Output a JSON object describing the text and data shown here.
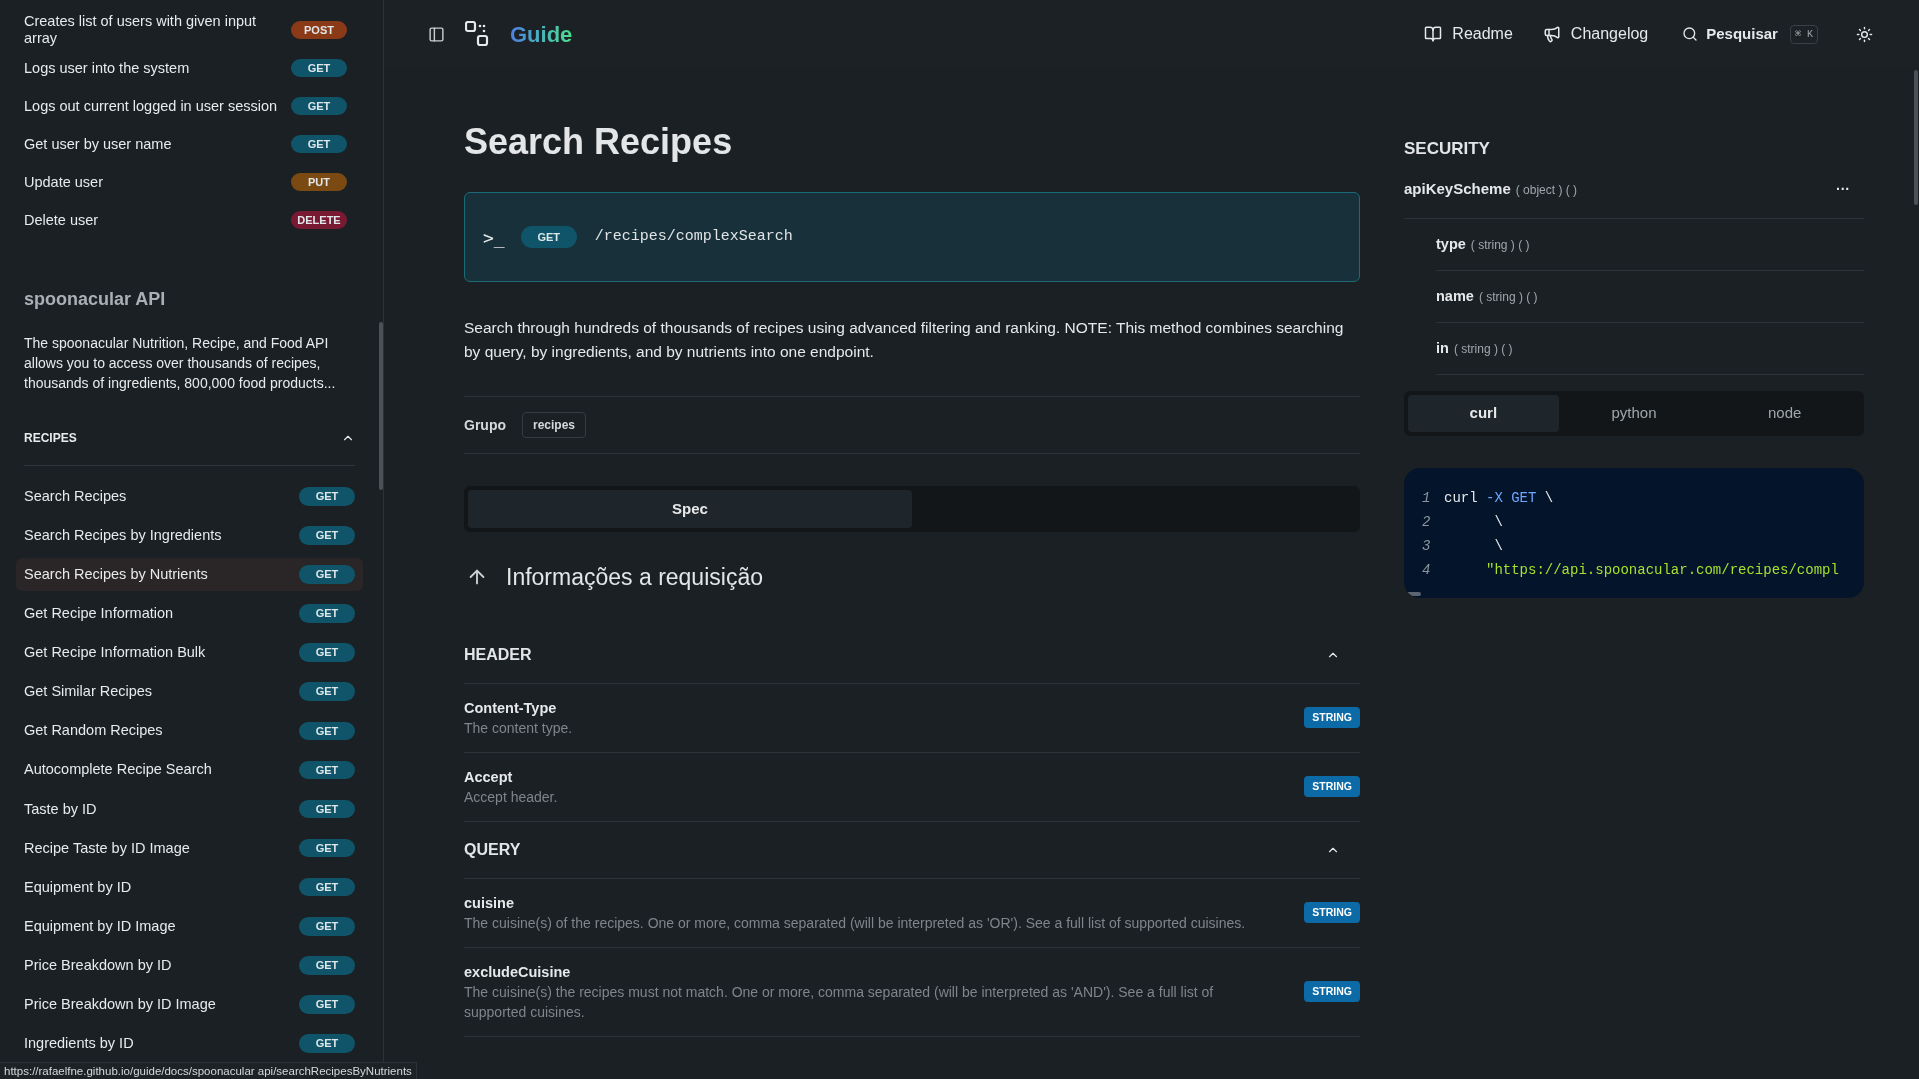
{
  "sidebar": {
    "top_items": [
      {
        "label": "Creates list of users with given input array",
        "method": "POST",
        "color": "#8a3a16"
      },
      {
        "label": "Logs user into the system",
        "method": "GET",
        "color": "#0f5468"
      },
      {
        "label": "Logs out current logged in user session",
        "method": "GET",
        "color": "#0f5468"
      },
      {
        "label": "Get user by user name",
        "method": "GET",
        "color": "#0f5468"
      },
      {
        "label": "Update user",
        "method": "PUT",
        "color": "#7a4a12"
      },
      {
        "label": "Delete user",
        "method": "DELETE",
        "color": "#7a1a32"
      }
    ],
    "api": {
      "title": "spoonacular API",
      "description": "The spoonacular Nutrition, Recipe, and Food API allows you to access over thousands of recipes, thousands of ingredients, 800,000 food products..."
    },
    "section": {
      "title": "RECIPES",
      "expanded": true
    },
    "items": [
      {
        "label": "Search Recipes",
        "method": "GET",
        "color": "#0f5468",
        "selected": false
      },
      {
        "label": "Search Recipes by Ingredients",
        "method": "GET",
        "color": "#0f5468",
        "selected": false
      },
      {
        "label": "Search Recipes by Nutrients",
        "method": "GET",
        "color": "#0f5468",
        "selected": true
      },
      {
        "label": "Get Recipe Information",
        "method": "GET",
        "color": "#0f5468",
        "selected": false
      },
      {
        "label": "Get Recipe Information Bulk",
        "method": "GET",
        "color": "#0f5468",
        "selected": false
      },
      {
        "label": "Get Similar Recipes",
        "method": "GET",
        "color": "#0f5468",
        "selected": false
      },
      {
        "label": "Get Random Recipes",
        "method": "GET",
        "color": "#0f5468",
        "selected": false
      },
      {
        "label": "Autocomplete Recipe Search",
        "method": "GET",
        "color": "#0f5468",
        "selected": false
      },
      {
        "label": "Taste by ID",
        "method": "GET",
        "color": "#0f5468",
        "selected": false
      },
      {
        "label": "Recipe Taste by ID Image",
        "method": "GET",
        "color": "#0f5468",
        "selected": false
      },
      {
        "label": "Equipment by ID",
        "method": "GET",
        "color": "#0f5468",
        "selected": false
      },
      {
        "label": "Equipment by ID Image",
        "method": "GET",
        "color": "#0f5468",
        "selected": false
      },
      {
        "label": "Price Breakdown by ID",
        "method": "GET",
        "color": "#0f5468",
        "selected": false
      },
      {
        "label": "Price Breakdown by ID Image",
        "method": "GET",
        "color": "#0f5468",
        "selected": false
      },
      {
        "label": "Ingredients by ID",
        "method": "GET",
        "color": "#0f5468",
        "selected": false
      }
    ]
  },
  "header": {
    "brand": "Guide",
    "links": [
      "Readme",
      "Changelog"
    ],
    "search": {
      "label": "Pesquisar",
      "shortcut": "⌘ K"
    }
  },
  "main": {
    "title": "Search Recipes",
    "endpoint": {
      "prompt": ">_",
      "method": "GET",
      "color": "#0f5468",
      "path": "/recipes/complexSearch"
    },
    "description": "Search through hundreds of thousands of recipes using advanced filtering and ranking. NOTE: This method combines searching by query, by ingredients, and by nutrients into one endpoint.",
    "group": {
      "label": "Grupo",
      "tag": "recipes"
    },
    "spec_tabs": [
      {
        "label": "Spec",
        "selected": true
      }
    ],
    "request_title": "Informações a requisição",
    "sections": [
      {
        "title": "HEADER",
        "expanded": true,
        "params": [
          {
            "name": "Content-Type",
            "description": "The content type.",
            "type": "STRING"
          },
          {
            "name": "Accept",
            "description": "Accept header.",
            "type": "STRING"
          }
        ]
      },
      {
        "title": "QUERY",
        "expanded": true,
        "params": [
          {
            "name": "cuisine",
            "description": "The cuisine(s) of the recipes. One or more, comma separated (will be interpreted as 'OR'). See a full list of supported cuisines.",
            "type": "STRING"
          },
          {
            "name": "excludeCuisine",
            "description": "The cuisine(s) the recipes must not match. One or more, comma separated (will be interpreted as 'AND'). See a full list of supported cuisines.",
            "type": "STRING"
          }
        ]
      }
    ]
  },
  "security": {
    "title": "SECURITY",
    "scheme": {
      "name": "apiKeyScheme",
      "meta": "( object ) ( )",
      "more": "···"
    },
    "fields": [
      {
        "name": "type",
        "meta": "( string ) ( )"
      },
      {
        "name": "name",
        "meta": "( string ) ( )"
      },
      {
        "name": "in",
        "meta": "( string ) ( )"
      }
    ]
  },
  "code_tabs": [
    {
      "label": "curl",
      "selected": true
    },
    {
      "label": "python",
      "selected": false
    },
    {
      "label": "node",
      "selected": false
    }
  ],
  "code": [
    {
      "number": "1",
      "tokens": [
        {
          "kind": "plain",
          "text": "curl "
        },
        {
          "kind": "keyword",
          "text": "-X GET "
        },
        {
          "kind": "plain",
          "text": "\\"
        }
      ]
    },
    {
      "number": "2",
      "tokens": [
        {
          "kind": "plain",
          "text": "      \\"
        }
      ]
    },
    {
      "number": "3",
      "tokens": [
        {
          "kind": "plain",
          "text": "      \\"
        }
      ]
    },
    {
      "number": "4",
      "tokens": [
        {
          "kind": "string",
          "text": "     \"https://api.spoonacular.com/recipes/compl"
        }
      ]
    }
  ],
  "status_bar": "https://rafaelfne.github.io/guide/docs/spoonacular api/searchRecipesByNutrients"
}
